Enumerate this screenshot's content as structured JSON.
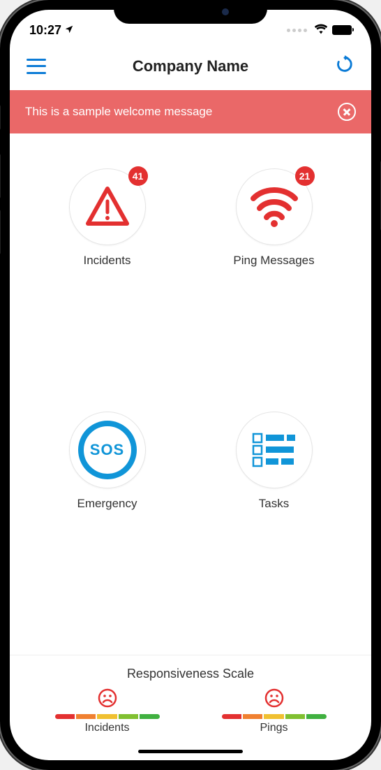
{
  "status": {
    "time": "10:27"
  },
  "header": {
    "title": "Company Name"
  },
  "banner": {
    "text": "This is a sample welcome message"
  },
  "tiles": {
    "incidents": {
      "label": "Incidents",
      "badge": "41"
    },
    "pings": {
      "label": "Ping Messages",
      "badge": "21"
    },
    "emergency": {
      "label": "Emergency",
      "sos": "SOS"
    },
    "tasks": {
      "label": "Tasks"
    }
  },
  "footer": {
    "title": "Responsiveness Scale",
    "incidents_label": "Incidents",
    "pings_label": "Pings"
  },
  "colors": {
    "accent_blue": "#0b7bd6",
    "accent_red": "#e33030",
    "banner_red": "#ea6868"
  }
}
